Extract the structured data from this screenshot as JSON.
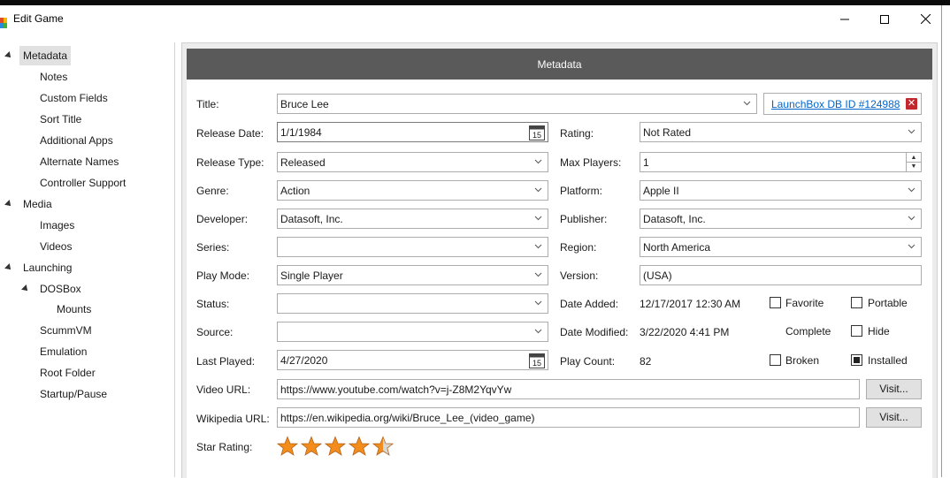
{
  "window": {
    "title": "Edit Game",
    "minimize_glyph": "—",
    "maximize_glyph": "☐",
    "close_glyph": "✕"
  },
  "tree": {
    "items": [
      {
        "label": "Metadata",
        "level": 1,
        "expanded": true,
        "selected": true
      },
      {
        "label": "Notes",
        "level": 2
      },
      {
        "label": "Custom Fields",
        "level": 2
      },
      {
        "label": "Sort Title",
        "level": 2
      },
      {
        "label": "Additional Apps",
        "level": 2
      },
      {
        "label": "Alternate Names",
        "level": 2
      },
      {
        "label": "Controller Support",
        "level": 2
      },
      {
        "label": "Media",
        "level": 1,
        "expanded": true
      },
      {
        "label": "Images",
        "level": 2
      },
      {
        "label": "Videos",
        "level": 2
      },
      {
        "label": "Launching",
        "level": 1,
        "expanded": true
      },
      {
        "label": "DOSBox",
        "level": 2,
        "expanded": true
      },
      {
        "label": "Mounts",
        "level": 3
      },
      {
        "label": "ScummVM",
        "level": 2
      },
      {
        "label": "Emulation",
        "level": 2
      },
      {
        "label": "Root Folder",
        "level": 2
      },
      {
        "label": "Startup/Pause",
        "level": 2
      }
    ]
  },
  "metadata": {
    "header": "Metadata",
    "title_label": "Title:",
    "title_value": "Bruce Lee",
    "launchbox_link": "LaunchBox DB ID #124988",
    "release_date_label": "Release Date:",
    "release_date_value": "1/1/1984",
    "calendar_day": "15",
    "release_type_label": "Release Type:",
    "release_type_value": "Released",
    "genre_label": "Genre:",
    "genre_value": "Action",
    "developer_label": "Developer:",
    "developer_value": "Datasoft, Inc.",
    "series_label": "Series:",
    "series_value": "",
    "play_mode_label": "Play Mode:",
    "play_mode_value": "Single Player",
    "status_label": "Status:",
    "status_value": "",
    "source_label": "Source:",
    "source_value": "",
    "last_played_label": "Last Played:",
    "last_played_value": "4/27/2020",
    "video_url_label": "Video URL:",
    "video_url_value": "https://www.youtube.com/watch?v=j-Z8M2YqvYw",
    "wikipedia_url_label": "Wikipedia URL:",
    "wikipedia_url_value": "https://en.wikipedia.org/wiki/Bruce_Lee_(video_game)",
    "visit_label": "Visit...",
    "star_rating_label": "Star Rating:",
    "star_rating_value": 4.5,
    "star_rating_max": 5,
    "rating_label": "Rating:",
    "rating_value": "Not Rated",
    "max_players_label": "Max Players:",
    "max_players_value": "1",
    "platform_label": "Platform:",
    "platform_value": "Apple II",
    "publisher_label": "Publisher:",
    "publisher_value": "Datasoft, Inc.",
    "region_label": "Region:",
    "region_value": "North America",
    "version_label": "Version:",
    "version_value": "(USA)",
    "date_added_label": "Date Added:",
    "date_added_value": "12/17/2017 12:30 AM",
    "date_modified_label": "Date Modified:",
    "date_modified_value": "3/22/2020 4:41 PM",
    "play_count_label": "Play Count:",
    "play_count_value": "82",
    "favorite_label": "Favorite",
    "favorite_checked": false,
    "portable_label": "Portable",
    "portable_checked": false,
    "complete_label": "Complete",
    "hide_label": "Hide",
    "hide_checked": false,
    "broken_label": "Broken",
    "broken_checked": false,
    "installed_label": "Installed",
    "installed_checked": true
  },
  "colors": {
    "header_bg": "#5a5a5a",
    "link": "#0066cc",
    "remove_red": "#c1272d",
    "star_fill": "#f28c1c",
    "star_empty": "#d8d8d8"
  }
}
